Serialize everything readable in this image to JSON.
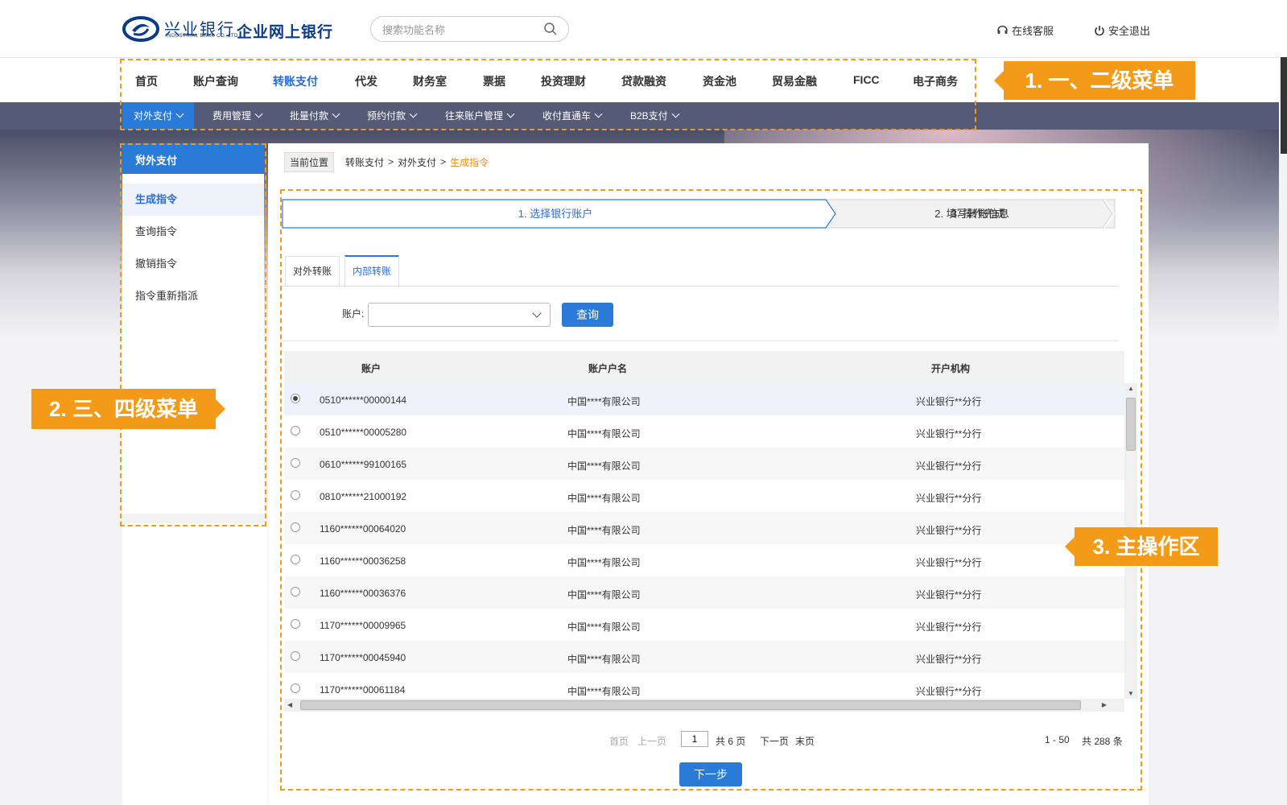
{
  "header": {
    "logo_cn": "兴业银行",
    "logo_en": "INDUSTRIAL BANK CO.,LTD",
    "app_title": "企业网上银行",
    "search_placeholder": "搜索功能名称",
    "service_label": "在线客服",
    "logout_label": "安全退出"
  },
  "main_nav": [
    "首页",
    "账户查询",
    "转账支付",
    "代发",
    "财务室",
    "票据",
    "投资理财",
    "贷款融资",
    "资金池",
    "贸易金融",
    "FICC",
    "电子商务"
  ],
  "sub_nav": [
    "对外支付",
    "费用管理",
    "批量付款",
    "预约付款",
    "往来账户管理",
    "收付直通车",
    "B2B支付"
  ],
  "side_menu": {
    "title": "对外支付",
    "collapse_icon": "double-chevron-left-icon",
    "items": [
      "生成指令",
      "查询指令",
      "撤销指令",
      "指令重新指派"
    ]
  },
  "breadcrumb": {
    "label": "当前位置",
    "path": [
      "转账支付",
      "对外支付"
    ],
    "current": "生成指令",
    "separator": ">"
  },
  "steps": [
    "1. 选择银行账户",
    "2. 填写转账信息",
    "3. 操作完成"
  ],
  "tabs": [
    "对外转账",
    "内部转账"
  ],
  "query": {
    "account_label": "账户:",
    "account_value": "",
    "button_label": "查询"
  },
  "table": {
    "columns": [
      "账户",
      "账户户名",
      "开户机构"
    ],
    "rows": [
      {
        "account": "0510******00000144",
        "name": "中国****有限公司",
        "branch": "兴业银行**分行"
      },
      {
        "account": "0510******00005280",
        "name": "中国****有限公司",
        "branch": "兴业银行**分行"
      },
      {
        "account": "0610******99100165",
        "name": "中国****有限公司",
        "branch": "兴业银行**分行"
      },
      {
        "account": "0810******21000192",
        "name": "中国****有限公司",
        "branch": "兴业银行**分行"
      },
      {
        "account": "1160******00064020",
        "name": "中国****有限公司",
        "branch": "兴业银行**分行"
      },
      {
        "account": "1160******00036258",
        "name": "中国****有限公司",
        "branch": "兴业银行**分行"
      },
      {
        "account": "1160******00036376",
        "name": "中国****有限公司",
        "branch": "兴业银行**分行"
      },
      {
        "account": "1170******00009965",
        "name": "中国****有限公司",
        "branch": "兴业银行**分行"
      },
      {
        "account": "1170******00045940",
        "name": "中国****有限公司",
        "branch": "兴业银行**分行"
      },
      {
        "account": "1170******00061184",
        "name": "中国****有限公司",
        "branch": "兴业银行**分行"
      }
    ]
  },
  "pagination": {
    "first": "首页",
    "prev": "上一页",
    "current_page": "1",
    "total_pages": "共 6 页",
    "next": "下一页",
    "last": "末页",
    "range": "1 - 50",
    "total_records": "共 288 条"
  },
  "next_step_label": "下一步",
  "annotations": [
    "1. 一、二级菜单",
    "2. 三、四级菜单",
    "3. 主操作区"
  ],
  "colors": {
    "primary": "#2a7ad8",
    "subnav_bg": "#555a77",
    "annotation": "#f39a18",
    "breadcrumb_current": "#f08a1e"
  }
}
